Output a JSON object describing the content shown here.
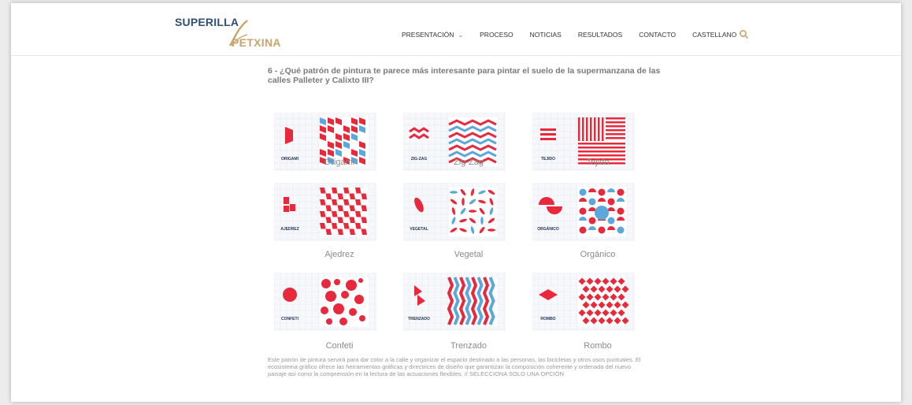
{
  "logo": {
    "line1": "SUPERILLA",
    "line2": "PETXINA"
  },
  "nav": {
    "items": [
      {
        "label": "PRESENTACIÓN",
        "has_caret": true
      },
      {
        "label": "PROCESO",
        "has_caret": false
      },
      {
        "label": "NOTICIAS",
        "has_caret": false
      },
      {
        "label": "RESULTADOS",
        "has_caret": false
      },
      {
        "label": "CONTACTO",
        "has_caret": false
      },
      {
        "label": "CASTELLANO",
        "has_caret": true
      }
    ],
    "caret": "⌄",
    "search_icon": "search-icon"
  },
  "question": {
    "text": "6 - ¿Qué patrón de pintura te parece más interesante para pintar el suelo de la supermanzana de las calles Palleter y Calixto III?"
  },
  "options": [
    {
      "caption": "Origami",
      "tile_label": "ORIGAMI",
      "pattern": "origami"
    },
    {
      "caption": "Zig-Zag",
      "tile_label": "ZIG-ZAG",
      "pattern": "zigzag"
    },
    {
      "caption": "Tejido",
      "tile_label": "TEJIDO",
      "pattern": "tejido"
    },
    {
      "caption": "Ajedrez",
      "tile_label": "AJEDREZ",
      "pattern": "ajedrez"
    },
    {
      "caption": "Vegetal",
      "tile_label": "VEGETAL",
      "pattern": "vegetal"
    },
    {
      "caption": "Orgánico",
      "tile_label": "ORGÁNICO",
      "pattern": "organico"
    },
    {
      "caption": "Confeti",
      "tile_label": "CONFETI",
      "pattern": "confeti"
    },
    {
      "caption": "Trenzado",
      "tile_label": "TRENZADO",
      "pattern": "trenzado"
    },
    {
      "caption": "Rombo",
      "tile_label": "ROMBO",
      "pattern": "rombo"
    }
  ],
  "note": {
    "text": "Este patrón de pintura servirá para dar color a la calle y organizar el espacio destinado a las personas, las bicicletas y otros usos puntuales. El ecosistema gráfico ofrece las herramientas gráficas y directrices de diseño que garantizan la composición coherente y ordenada del nuevo paisaje así como la comprensión en la lectura de las actuaciones flexibles. // SELECCIONA SOLO UNA OPCIÓN"
  },
  "colors": {
    "red": "#e8293b",
    "blue": "#5aa8dc",
    "navy": "#1f3452",
    "gold": "#c8a46a",
    "text_gray": "#8a8a8a"
  }
}
